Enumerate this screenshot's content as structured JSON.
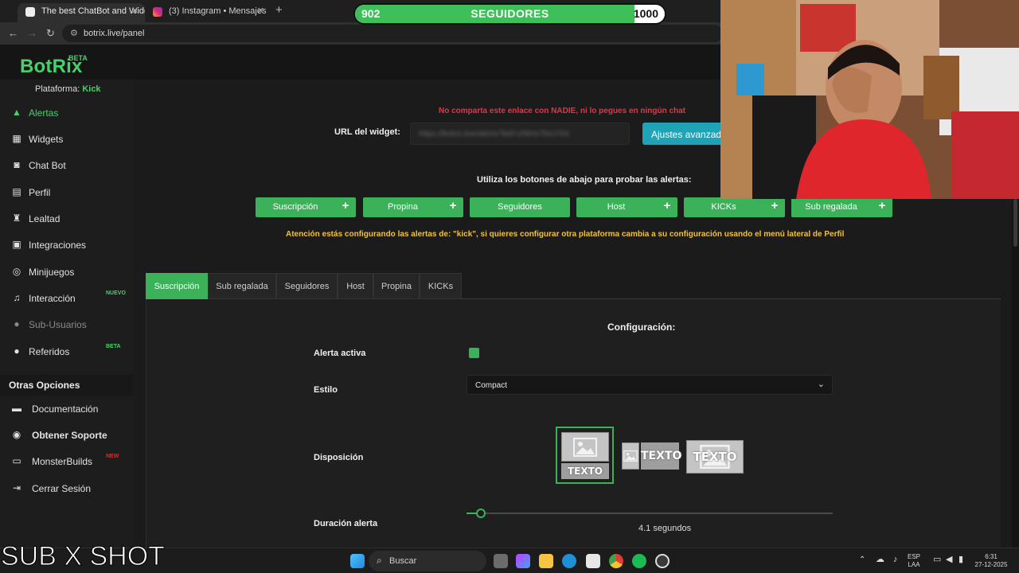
{
  "browser": {
    "tabs": [
      {
        "title": "The best ChatBot and Widgets f",
        "active": true
      },
      {
        "title": "(3) Instagram • Mensajes",
        "active": false
      }
    ],
    "url": "botrix.live/panel"
  },
  "overlay": {
    "counter": {
      "current": "902",
      "label": "SEGUIDORES",
      "goal": "1000",
      "progress": 0.902
    },
    "caption": "SUB X SHOT"
  },
  "brand": {
    "name": "BotRix",
    "badge": "BETA",
    "accent": "#47d06b"
  },
  "sidebar": {
    "platform_label": "Plataforma:",
    "platform_value": "Kick",
    "items": [
      {
        "label": "Alertas",
        "icon": "warning-icon",
        "selected": true
      },
      {
        "label": "Widgets",
        "icon": "grid-icon"
      },
      {
        "label": "Chat Bot",
        "icon": "robot-icon"
      },
      {
        "label": "Perfil",
        "icon": "id-card-icon"
      },
      {
        "label": "Lealtad",
        "icon": "trophy-icon"
      },
      {
        "label": "Integraciones",
        "icon": "puzzle-icon"
      },
      {
        "label": "Minijuegos",
        "icon": "gamepad-icon"
      },
      {
        "label": "Interacción",
        "icon": "music-icon",
        "tag": "NUEVO"
      },
      {
        "label": "Sub-Usuarios",
        "icon": "users-icon",
        "dim": true
      },
      {
        "label": "Referidos",
        "icon": "users-icon",
        "tag": "BETA"
      }
    ],
    "other_title": "Otras Opciones",
    "other_items": [
      {
        "label": "Documentación",
        "icon": "book-icon"
      },
      {
        "label": "Obtener Soporte",
        "icon": "support-icon"
      },
      {
        "label": "MonsterBuilds",
        "icon": "monitor-icon",
        "tag": "NEW"
      },
      {
        "label": "Cerrar Sesión",
        "icon": "logout-icon"
      }
    ]
  },
  "main": {
    "share_warning": "No comparta este enlace con NADIE, ni lo pegues en ningún chat",
    "url_label": "URL del widget:",
    "url_value": "https://botrix.live/alerts?bid=zNtHx7bm7X4",
    "advanced_button": "Ajustes avanzados",
    "test_prompt": "Utiliza los botones de abajo para probar las alertas:",
    "test_buttons": [
      "Suscripción",
      "Propina",
      "Seguidores",
      "Host",
      "KICKs",
      "Sub regalada"
    ],
    "platform_notice": "Atención estás configurando las alertas de: \"kick\", si quieres configurar otra plataforma cambia a su configuración usando el menú lateral de Perfil",
    "alert_tabs": [
      "Suscripción",
      "Sub regalada",
      "Seguidores",
      "Host",
      "Propina",
      "KICKs"
    ],
    "active_tab": 0,
    "config": {
      "title": "Configuración:",
      "active_label": "Alerta activa",
      "active_value": true,
      "style_label": "Estilo",
      "style_value": "Compact",
      "layout_label": "Disposición",
      "layout_text": "TEXTO",
      "layout_selected": 0,
      "duration_label": "Duración alerta",
      "duration_value": "4.1",
      "duration_unit": "segundos",
      "duration_fraction": 0.025
    }
  },
  "taskbar": {
    "search_placeholder": "Buscar",
    "lang": "ESP",
    "lang_sub": "LAA",
    "time": "6:31",
    "date": "27-12-2025"
  }
}
